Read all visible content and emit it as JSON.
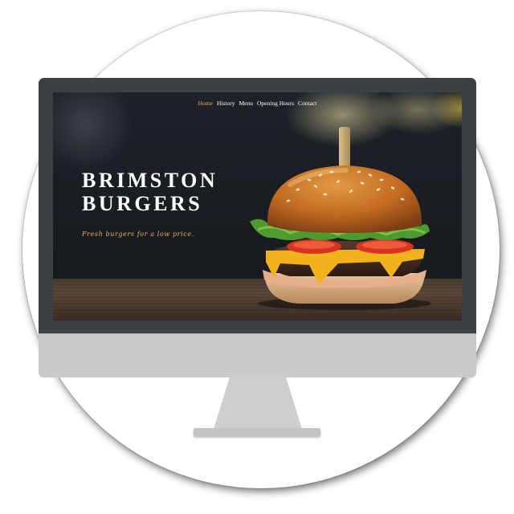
{
  "nav": {
    "items": [
      {
        "label": "Home",
        "active": true
      },
      {
        "label": "History",
        "active": false
      },
      {
        "label": "Menu",
        "active": false
      },
      {
        "label": "Opening Hours",
        "active": false
      },
      {
        "label": "Contact",
        "active": false
      }
    ]
  },
  "hero": {
    "title_line1": "BRIMSTON",
    "title_line2": "BURGERS",
    "tagline": "Fresh burgers for a low price."
  },
  "colors": {
    "accent": "#e6b25a",
    "bezel": "#3b4045",
    "chin": "#c9cbcd"
  },
  "icons": [
    "burger-image",
    "monitor-stand"
  ]
}
